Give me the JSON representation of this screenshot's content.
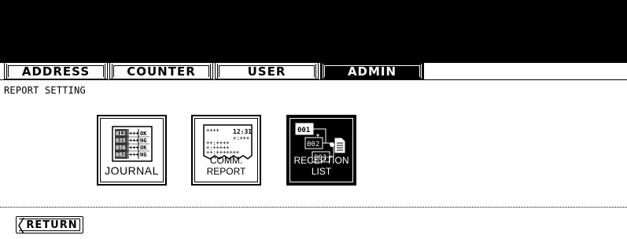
{
  "tabs": [
    {
      "id": "address",
      "label": "ADDRESS",
      "active": false
    },
    {
      "id": "counter",
      "label": "COUNTER",
      "active": false
    },
    {
      "id": "user",
      "label": "USER",
      "active": false
    },
    {
      "id": "admin",
      "label": "ADMIN",
      "active": true
    }
  ],
  "section": {
    "title": "REPORT SETTING"
  },
  "buttons": {
    "journal": {
      "label": "JOURNAL",
      "icon": "journal-icon",
      "glyphs": {
        "r1": "012",
        "r2": "035",
        "r3": "056",
        "r4": "082",
        "stars": "+++",
        "ok": "OK",
        "ng": "NG"
      }
    },
    "comm_report": {
      "label": "COMM. REPORT",
      "icon": "comm-report-icon",
      "glyphs": {
        "stars_top": "++++",
        "time": "12:31",
        "stars_mid": "+:+++",
        "stars_a": "++:++++",
        "stars_b": "+:+++++",
        "stars_c": "++:+++++++"
      }
    },
    "reception_list": {
      "label": "RECEPTION LIST",
      "icon": "reception-list-icon",
      "selected": true,
      "glyphs": {
        "n1": "001",
        "n2": "002",
        "n3": "003"
      }
    }
  },
  "footer": {
    "return_label": "RETURN"
  }
}
